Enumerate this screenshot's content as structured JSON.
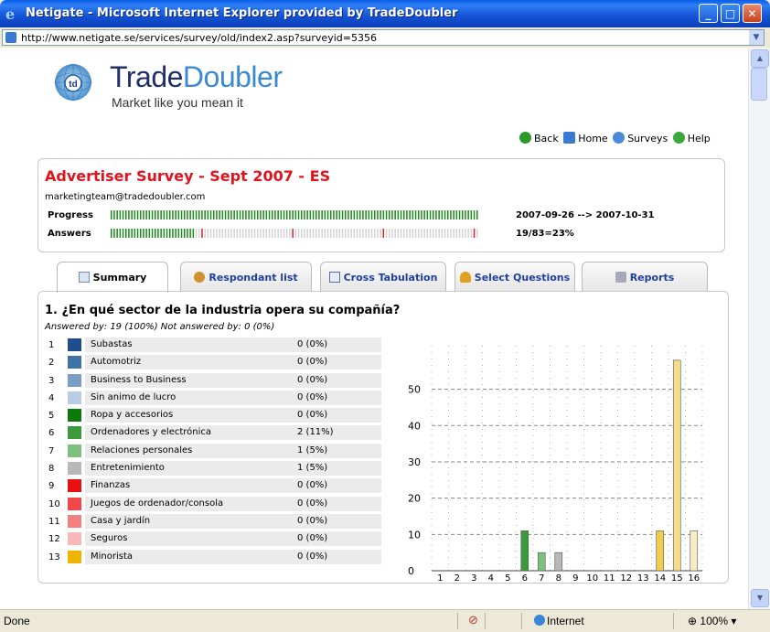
{
  "window": {
    "title": "Netigate - Microsoft Internet Explorer provided by TradeDoubler",
    "url": "http://www.netigate.se/services/survey/old/index2.asp?surveyid=5356"
  },
  "status": {
    "text": "Done",
    "zone": "Internet",
    "zoom": "100%"
  },
  "logo": {
    "word_a": "Trade",
    "word_b": "Doubler",
    "tagline": "Market like you mean it",
    "badge": "td"
  },
  "nav": {
    "back": "Back",
    "home": "Home",
    "surveys": "Surveys",
    "help": "Help"
  },
  "survey": {
    "title": "Advertiser Survey - Sept 2007 - ES",
    "email": "marketingteam@tradedoubler.com",
    "progress_label": "Progress",
    "progress_value": "2007-09-26 --> 2007-10-31",
    "progress_fraction": 1.0,
    "answers_label": "Answers",
    "answers_value": "19/83=23%",
    "answers_fraction": 0.23
  },
  "tabs": [
    {
      "label": "Summary"
    },
    {
      "label": "Respondant list"
    },
    {
      "label": "Cross Tabulation"
    },
    {
      "label": "Select Questions"
    },
    {
      "label": "Reports"
    }
  ],
  "question": {
    "title": "1. ¿En qué sector de la industria opera su compañía?",
    "answered": "Answered by: 19 (100%) Not answered by: 0 (0%)",
    "options": [
      {
        "num": "1",
        "label": "Subastas",
        "count": "0 (0%)",
        "color": "#1f4e8c"
      },
      {
        "num": "2",
        "label": "Automotriz",
        "count": "0 (0%)",
        "color": "#3f73a6"
      },
      {
        "num": "3",
        "label": "Business to Business",
        "count": "0 (0%)",
        "color": "#7a9ec6"
      },
      {
        "num": "4",
        "label": "Sin animo de lucro",
        "count": "0 (0%)",
        "color": "#b9cde2"
      },
      {
        "num": "5",
        "label": "Ropa y accesorios",
        "count": "0 (0%)",
        "color": "#0a7a0a"
      },
      {
        "num": "6",
        "label": "Ordenadores y electrónica",
        "count": "2 (11%)",
        "color": "#3c9a3c"
      },
      {
        "num": "7",
        "label": "Relaciones personales",
        "count": "1 (5%)",
        "color": "#7dc07d"
      },
      {
        "num": "8",
        "label": "Entretenimiento",
        "count": "1 (5%)",
        "color": "#b8b8b8"
      },
      {
        "num": "9",
        "label": "Finanzas",
        "count": "0 (0%)",
        "color": "#e81010"
      },
      {
        "num": "10",
        "label": "Juegos de ordenador/consola",
        "count": "0 (0%)",
        "color": "#f04848"
      },
      {
        "num": "11",
        "label": "Casa y jardín",
        "count": "0 (0%)",
        "color": "#f48080"
      },
      {
        "num": "12",
        "label": "Seguros",
        "count": "0 (0%)",
        "color": "#f8b8b8"
      },
      {
        "num": "13",
        "label": "Minorista",
        "count": "0 (0%)",
        "color": "#f0b400"
      }
    ]
  },
  "chart_data": {
    "type": "bar",
    "categories": [
      "1",
      "2",
      "3",
      "4",
      "5",
      "6",
      "7",
      "8",
      "9",
      "10",
      "11",
      "12",
      "13",
      "14",
      "15",
      "16"
    ],
    "values": [
      0,
      0,
      0,
      0,
      0,
      11,
      5,
      5,
      0,
      0,
      0,
      0,
      0,
      11,
      58,
      11
    ],
    "colors": [
      "#1f4e8c",
      "#3f73a6",
      "#7a9ec6",
      "#b9cde2",
      "#0a7a0a",
      "#3c9a3c",
      "#7dc07d",
      "#b8b8b8",
      "#e81010",
      "#f04848",
      "#f48080",
      "#f8b8b8",
      "#f0b400",
      "#f0cc50",
      "#f4dc8c",
      "#f8ecc4"
    ],
    "yticks": [
      0,
      10,
      20,
      30,
      40,
      50
    ],
    "ylim": [
      0,
      62
    ],
    "grid": true
  }
}
